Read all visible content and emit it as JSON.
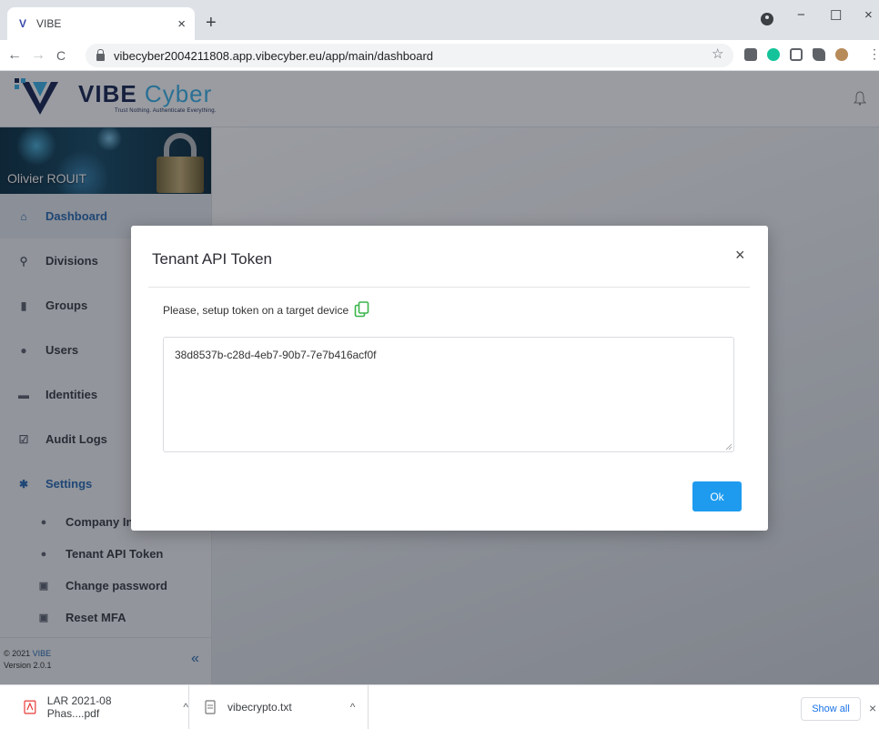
{
  "browser": {
    "tab_title": "VIBE",
    "tab_close": "×",
    "new_tab": "+",
    "url": "vibecyber2004211808.app.vibecyber.eu/app/main/dashboard",
    "nav": {
      "back": "←",
      "forward": "→",
      "reload": "C"
    },
    "star": "☆",
    "window": {
      "minimize": "−",
      "maximize": "☐",
      "close": "×"
    },
    "extensions": [
      "extension-icon",
      "grammarly-icon",
      "bitwarden-icon",
      "puzzle-icon",
      "profile-avatar"
    ]
  },
  "app": {
    "logo_word1": "VIBE",
    "logo_word2": "Cyber",
    "tagline": "Trust Nothing. Authenticate Everything.",
    "brand_colors": {
      "navy": "#1d2a55",
      "cyan": "#3db3e8"
    }
  },
  "sidebar": {
    "user_name": "Olivier ROUIT",
    "items": [
      {
        "label": "Dashboard",
        "icon": "home-icon"
      },
      {
        "label": "Divisions",
        "icon": "sitemap-icon"
      },
      {
        "label": "Groups",
        "icon": "bars-icon"
      },
      {
        "label": "Users",
        "icon": "user-icon"
      },
      {
        "label": "Identities",
        "icon": "id-card-icon"
      },
      {
        "label": "Audit Logs",
        "icon": "checkbox-icon"
      },
      {
        "label": "Settings",
        "icon": "gear-icon"
      }
    ],
    "sub_items": [
      {
        "label": "Company In",
        "icon": "info-icon"
      },
      {
        "label": "Tenant API Token",
        "icon": "info-icon"
      },
      {
        "label": "Change password",
        "icon": "lock-icon"
      },
      {
        "label": "Reset MFA",
        "icon": "lock-icon"
      }
    ],
    "footer": {
      "copyright_prefix": "© 2021 ",
      "brand": "VIBE",
      "version": "Version 2.0.1",
      "collapse": "«"
    }
  },
  "modal": {
    "title": "Tenant API Token",
    "close": "×",
    "hint": "Please, setup token on a target device",
    "token": "38d8537b-c28d-4eb7-90b7-7e7b416acf0f",
    "ok_label": "Ok",
    "accent": "#1e9bef"
  },
  "downloads": {
    "items": [
      {
        "name": "LAR 2021-08 Phas....pdf",
        "icon": "pdf-icon"
      },
      {
        "name": "vibecrypto.txt",
        "icon": "file-icon"
      }
    ],
    "caret": "^",
    "show_all": "Show all",
    "close": "×"
  }
}
